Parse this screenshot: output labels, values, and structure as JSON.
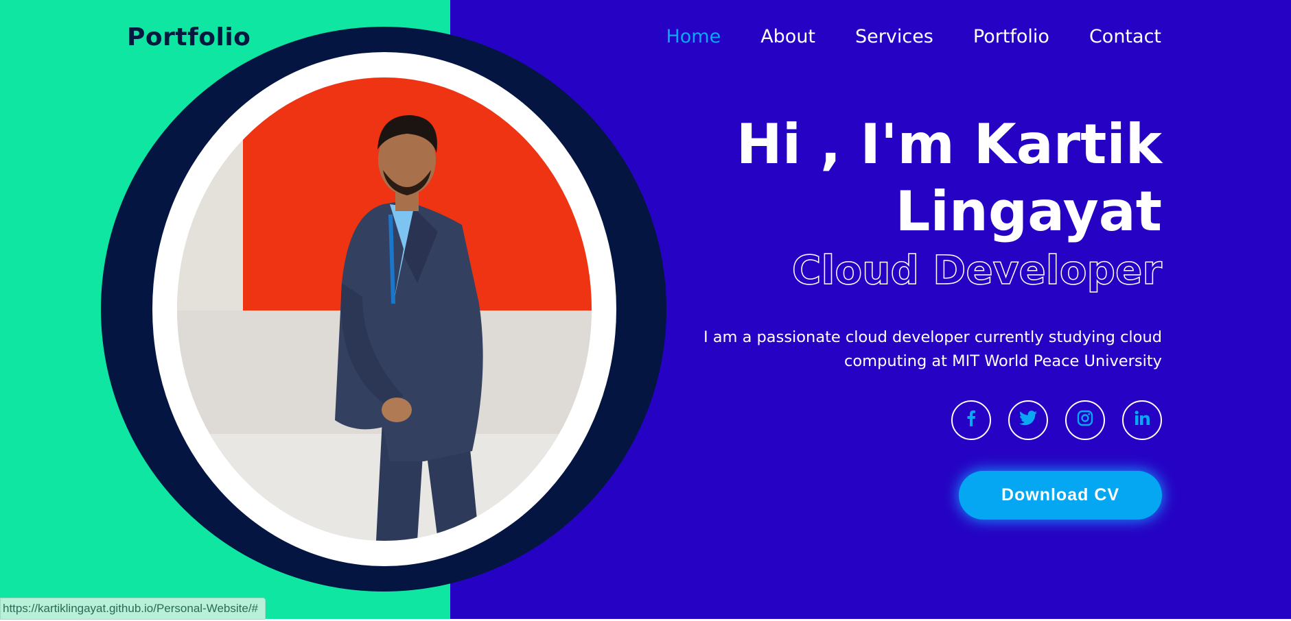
{
  "header": {
    "logo": "Portfolio",
    "nav": [
      {
        "label": "Home",
        "active": true
      },
      {
        "label": "About",
        "active": false
      },
      {
        "label": "Services",
        "active": false
      },
      {
        "label": "Portfolio",
        "active": false
      },
      {
        "label": "Contact",
        "active": false
      }
    ]
  },
  "hero": {
    "title_line1": "Hi , I'm Kartik",
    "title_line2": "Lingayat",
    "role": "Cloud Developer",
    "description": "I am a passionate cloud developer currently studying cloud computing at MIT World Peace University",
    "socials": [
      {
        "icon": "facebook-icon",
        "glyph": "f"
      },
      {
        "icon": "twitter-icon",
        "glyph": "t"
      },
      {
        "icon": "instagram-icon",
        "glyph": "ig"
      },
      {
        "icon": "linkedin-icon",
        "glyph": "in"
      }
    ],
    "cta_label": "Download CV"
  },
  "status_bar": {
    "url": "https://kartiklingayat.github.io/Personal-Website/#"
  },
  "colors": {
    "left_panel": "#0fe6a1",
    "right_panel": "#2603c4",
    "accent": "#0aa8f4",
    "dark_ring": "#041542"
  }
}
